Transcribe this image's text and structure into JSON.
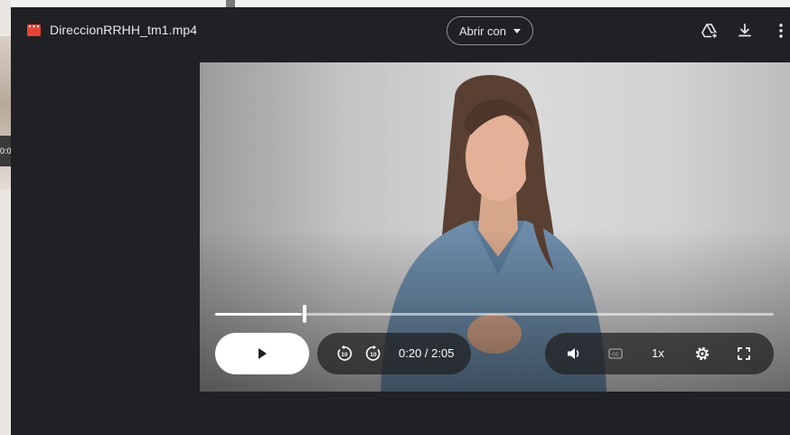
{
  "file": {
    "name": "DireccionRRHH_tm1.mp4",
    "icon": "video-file-icon"
  },
  "toolbar": {
    "open_with_label": "Abrir con",
    "icons": [
      "add-to-drive-icon",
      "download-icon",
      "more-vert-icon"
    ]
  },
  "background": {
    "thumbnail_time": "0:0"
  },
  "player": {
    "time_display": "0:20 / 2:05",
    "current_seconds": 20,
    "duration_seconds": 125,
    "speed_label": "1x",
    "controls": [
      "play-icon",
      "rewind-10-icon",
      "forward-10-icon",
      "volume-icon",
      "captions-icon",
      "settings-icon",
      "fullscreen-icon"
    ]
  },
  "colors": {
    "viewer_background": "#202124",
    "file_icon": "#ea4335",
    "text": "#e8eaed"
  }
}
